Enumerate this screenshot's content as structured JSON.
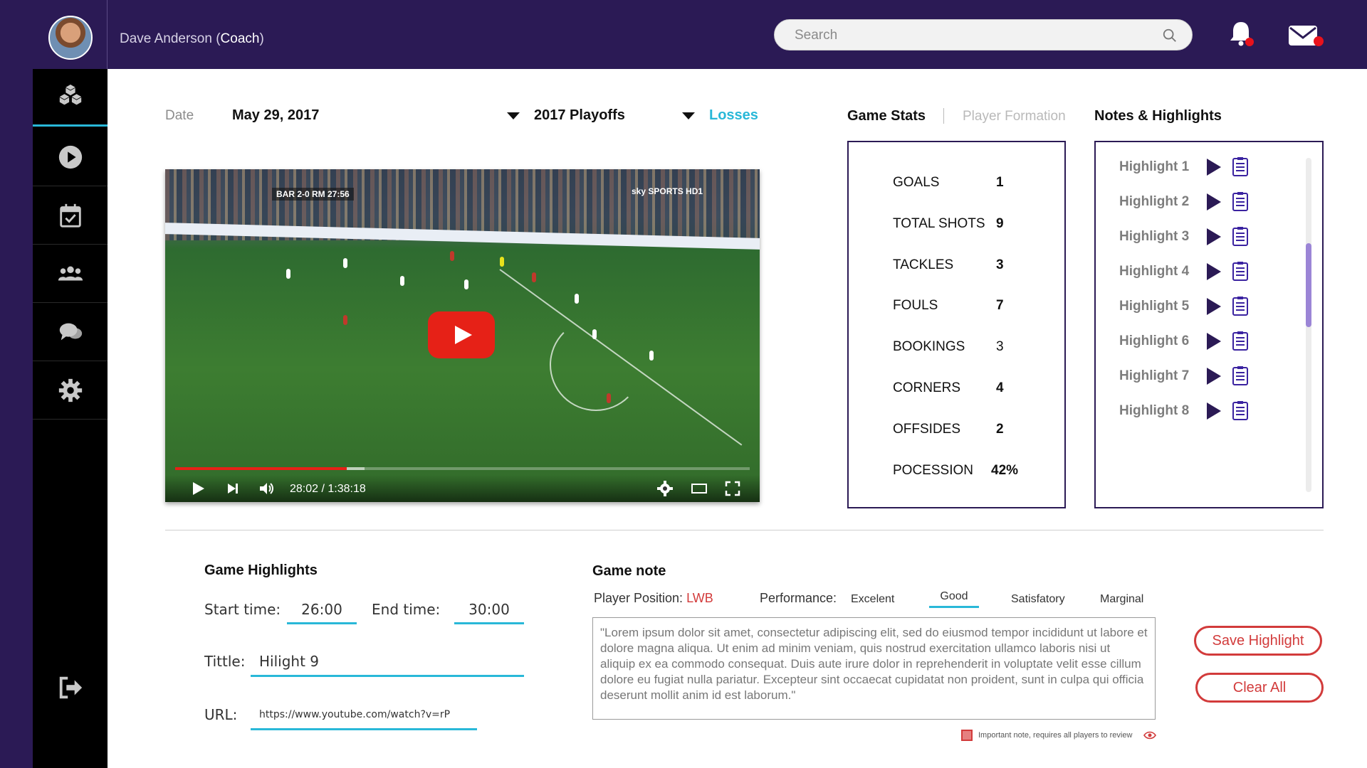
{
  "header": {
    "user_name": "Dave Anderson",
    "user_role_open": " (",
    "user_role": "Coach",
    "user_role_close": ")",
    "search_placeholder": "Search"
  },
  "sidebar": {
    "items": [
      {
        "icon": "cubes-icon"
      },
      {
        "icon": "play-circle-icon"
      },
      {
        "icon": "calendar-check-icon"
      },
      {
        "icon": "team-icon"
      },
      {
        "icon": "chat-icon"
      },
      {
        "icon": "gear-icon"
      }
    ],
    "logout_icon": "logout-icon"
  },
  "filters": {
    "date_label": "Date",
    "date_value": "May 29, 2017",
    "season": "2017 Playoffs",
    "result": "Losses"
  },
  "tabs": {
    "game_stats": "Game Stats",
    "player_formation": "Player Formation",
    "notes_highlights": "Notes & Highlights"
  },
  "video": {
    "score": "BAR 2-0 RM 27:56",
    "channel": "sky SPORTS HD1",
    "time_display": "28:02 / 1:38:18",
    "played_fraction": 0.2985,
    "buffered_fraction": 0.33
  },
  "stats": [
    {
      "label": "GOALS",
      "value": "1"
    },
    {
      "label": "TOTAL SHOTS",
      "value": "9"
    },
    {
      "label": "TACKLES",
      "value": "3"
    },
    {
      "label": "FOULS",
      "value": "7"
    },
    {
      "label": "BOOKINGS",
      "value": "3"
    },
    {
      "label": "CORNERS",
      "value": "4"
    },
    {
      "label": "OFFSIDES",
      "value": "2"
    },
    {
      "label": "POCESSION",
      "value": "42%"
    }
  ],
  "highlights": [
    {
      "label": "Highlight 1"
    },
    {
      "label": "Highlight 2"
    },
    {
      "label": "Highlight 3"
    },
    {
      "label": "Highlight 4"
    },
    {
      "label": "Highlight 5"
    },
    {
      "label": "Highlight 6"
    },
    {
      "label": "Highlight 7"
    },
    {
      "label": "Highlight 8"
    }
  ],
  "game_highlights": {
    "title": "Game Highlights",
    "start_label": "Start time:",
    "start_value": "26:00",
    "end_label": "End time:",
    "end_value": "30:00",
    "title_label": "Tittle:",
    "title_value": "Hilight 9",
    "url_label": "URL:",
    "url_value": "https://www.youtube.com/watch?v=rP"
  },
  "game_note": {
    "title": "Game note",
    "position_label": "Player Position: ",
    "position_value": "LWB",
    "performance_label": "Performance:",
    "performance_options": [
      "Excelent",
      "Good",
      "Satisfatory",
      "Marginal"
    ],
    "performance_selected": "Good",
    "note_text": "\"Lorem ipsum dolor sit amet, consectetur adipiscing elit, sed do eiusmod tempor incididunt ut labore et dolore magna aliqua. Ut enim ad minim veniam, quis nostrud exercitation ullamco laboris nisi ut aliquip ex ea commodo consequat. Duis aute irure dolor in reprehenderit in voluptate velit esse cillum dolore eu fugiat nulla pariatur. Excepteur sint occaecat cupidatat non proident, sunt in culpa qui officia deserunt mollit anim id est laborum.\"",
    "important_text": "Important note, requires all players to review"
  },
  "buttons": {
    "save_highlight": "Save Highlight",
    "clear_all": "Clear All"
  },
  "colors": {
    "brand_purple": "#2b1a55",
    "accent_cyan": "#29b8d8",
    "danger_red": "#d23b3b"
  }
}
